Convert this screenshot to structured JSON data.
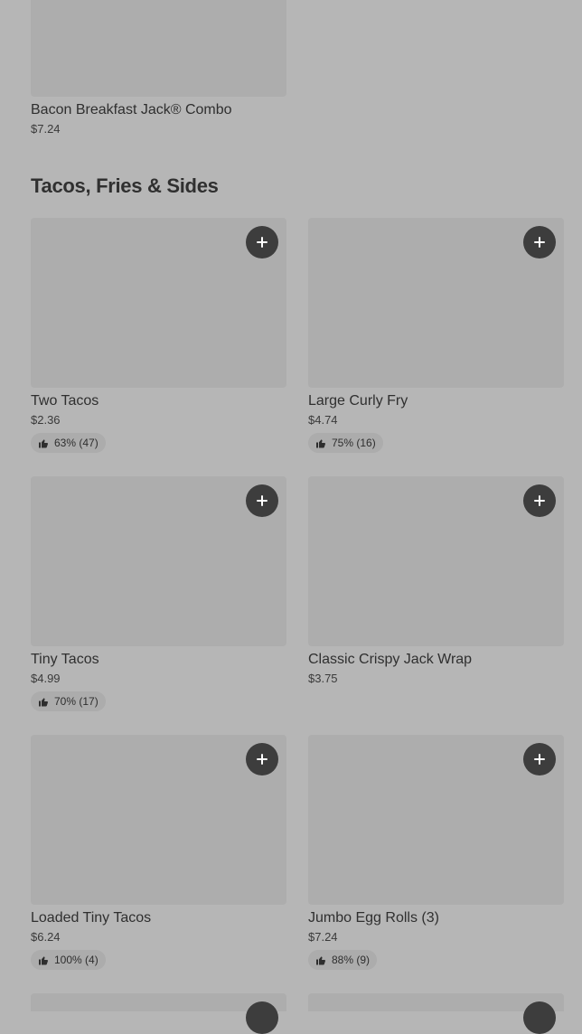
{
  "top_item": {
    "name": "Bacon Breakfast Jack®  Combo",
    "price": "$7.24"
  },
  "section": {
    "title": "Tacos, Fries & Sides"
  },
  "items": [
    {
      "name": "Two Tacos",
      "price": "$2.36",
      "rating": "63% (47)"
    },
    {
      "name": "Large Curly Fry",
      "price": "$4.74",
      "rating": "75% (16)"
    },
    {
      "name": "Tiny Tacos",
      "price": "$4.99",
      "rating": "70% (17)"
    },
    {
      "name": "Classic Crispy Jack Wrap",
      "price": "$3.75",
      "rating": null
    },
    {
      "name": "Loaded Tiny Tacos",
      "price": "$6.24",
      "rating": "100% (4)"
    },
    {
      "name": "Jumbo Egg Rolls (3)",
      "price": "$7.24",
      "rating": "88% (9)"
    }
  ],
  "icons": {
    "add": "plus-icon",
    "rating": "thumbs-up-icon"
  },
  "colors": {
    "background": "#b6b6b6",
    "image_placeholder": "#adadad",
    "add_button": "#3d3d3d"
  }
}
